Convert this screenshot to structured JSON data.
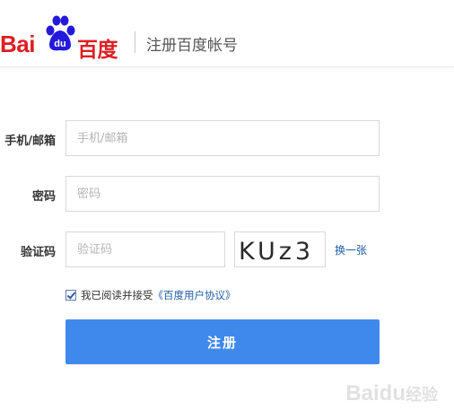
{
  "header": {
    "logo_latin_1": "Bai",
    "logo_latin_2": "du",
    "logo_cn": "百度",
    "title": "注册百度帐号"
  },
  "form": {
    "phone_email": {
      "label": "手机/邮箱",
      "placeholder": "手机/邮箱"
    },
    "password": {
      "label": "密码",
      "placeholder": "密码"
    },
    "verify": {
      "label": "验证码",
      "placeholder": "验证码",
      "captcha_text": "KUz3",
      "refresh_label": "换一张"
    },
    "agreement": {
      "prefix": "我已阅读并接受",
      "link": "《百度用户协议》",
      "checked": true
    },
    "submit_label": "注册"
  },
  "watermark": {
    "latin": "Bai",
    "latin2": "du",
    "cn": "经验"
  },
  "colors": {
    "brand_red": "#de1e22",
    "brand_blue": "#2319dc",
    "button_blue": "#3f89ec",
    "link_blue": "#1f5ea8"
  }
}
